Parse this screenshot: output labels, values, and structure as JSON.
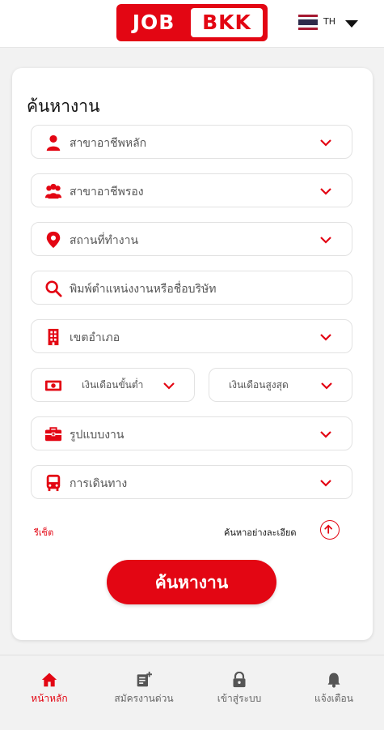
{
  "header": {
    "logo_text_job": "JOB",
    "logo_text_bkk": "BKK",
    "language_code": "TH"
  },
  "search_form": {
    "title": "ค้นหางาน",
    "fields": {
      "main_occupation": {
        "label": "สาขาอาชีพหลัก",
        "icon": "person-icon"
      },
      "sub_occupation": {
        "label": "สาขาอาชีพรอง",
        "icon": "people-icon"
      },
      "workplace": {
        "label": "สถานที่ทำงาน",
        "icon": "location-pin-icon"
      },
      "keyword": {
        "placeholder": "พิมพ์ตำแหน่งงานหรือชื่อบริษัท",
        "icon": "search-icon"
      },
      "district": {
        "label": "เขตอำเภอ",
        "icon": "building-icon"
      },
      "salary_min": {
        "label": "เงินเดือนขั้นต่ำ",
        "icon": "money-icon"
      },
      "salary_max": {
        "label": "เงินเดือนสูงสุด"
      },
      "job_type": {
        "label": "รูปแบบงาน",
        "icon": "briefcase-icon"
      },
      "transport": {
        "label": "การเดินทาง",
        "icon": "bus-icon"
      }
    },
    "reset_label": "รีเซ็ต",
    "advanced_search_label": "ค้นหาอย่างละเอียด",
    "search_button_label": "ค้นหางาน"
  },
  "bottom_nav": {
    "items": [
      {
        "label": "หน้าหลัก",
        "icon": "home-icon",
        "active": true
      },
      {
        "label": "สมัครงานด่วน",
        "icon": "quick-apply-icon",
        "active": false
      },
      {
        "label": "เข้าสู่ระบบ",
        "icon": "lock-icon",
        "active": false
      },
      {
        "label": "แจ้งเตือน",
        "icon": "bell-icon",
        "active": false
      }
    ]
  },
  "colors": {
    "brand_red": "#e30613",
    "background": "#f2f2f2",
    "card": "#ffffff"
  }
}
